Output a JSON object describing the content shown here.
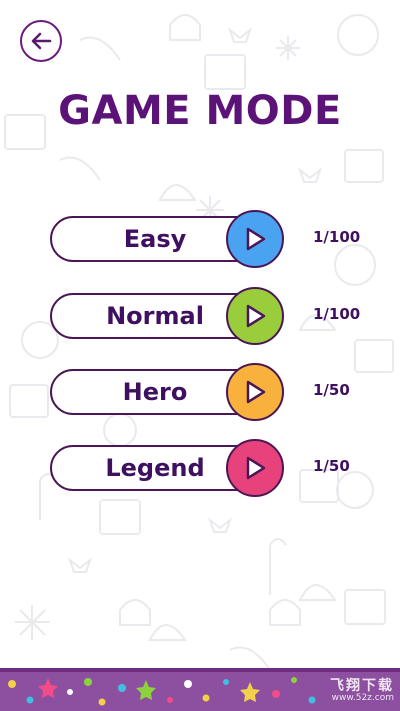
{
  "header": {
    "title": "GAME MODE",
    "back_icon": "arrow-left-icon"
  },
  "modes": [
    {
      "label": "Easy",
      "progress": "1/100",
      "color": "#4aa3f0",
      "icon": "play-icon"
    },
    {
      "label": "Normal",
      "progress": "1/100",
      "color": "#9acd3c",
      "icon": "play-icon"
    },
    {
      "label": "Hero",
      "progress": "1/50",
      "color": "#f8b13c",
      "icon": "play-icon"
    },
    {
      "label": "Legend",
      "progress": "1/50",
      "color": "#e8427c",
      "icon": "play-icon"
    }
  ],
  "theme": {
    "title_color": "#5c1378",
    "outline_color": "#4b1656",
    "footer_color": "#8d4f9f"
  },
  "watermark": {
    "main": "飞翔下载",
    "sub": "www.52z.com"
  }
}
